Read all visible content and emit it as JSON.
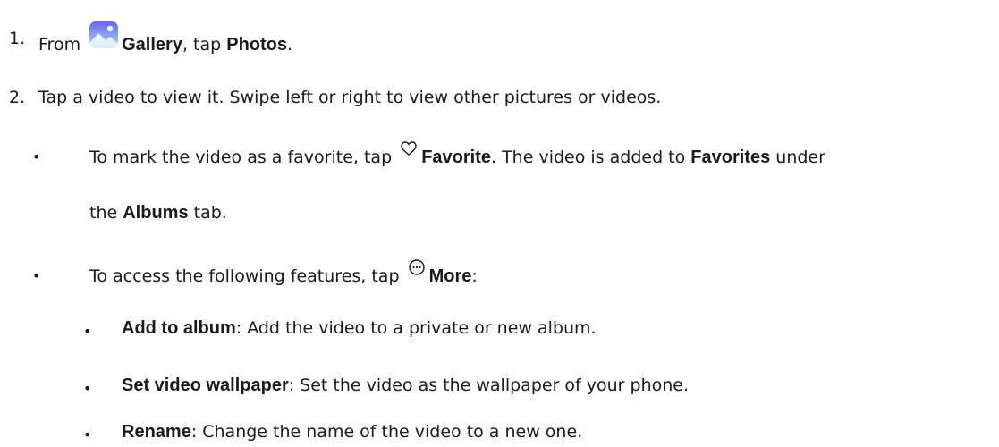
{
  "steps": [
    {
      "number": "1.",
      "prefix": "From",
      "gallery": "Gallery",
      "mid": ", tap",
      "photos": "Photos",
      "suffix": "."
    },
    {
      "number": "2.",
      "text": "Tap a video to view it. Swipe left or right to view other pictures or videos."
    }
  ],
  "favorite": {
    "prefix": "To mark the video as a favorite, tap",
    "label": "Favorite",
    "middle": ". The video is added to",
    "favorites": "Favorites",
    "under": "under",
    "line2_the": "the",
    "albums": "Albums",
    "line2_tab": "tab."
  },
  "more": {
    "prefix": "To access the following features, tap",
    "label": "More",
    "suffix": ":"
  },
  "features": [
    {
      "title": "Add to album",
      "desc": ": Add the video to a private or new album."
    },
    {
      "title": "Set video wallpaper",
      "desc": ": Set the video as the wallpaper of your phone."
    },
    {
      "title": "Rename",
      "desc": ": Change the name of the video to a new one."
    }
  ],
  "icons": {
    "gallery": "gallery-icon",
    "favorite": "heart-icon",
    "more": "more-icon"
  },
  "colors": {
    "gallery_top": "#6b63f2",
    "gallery_bottom": "#8fd3f5",
    "text": "#1a1a1a"
  }
}
